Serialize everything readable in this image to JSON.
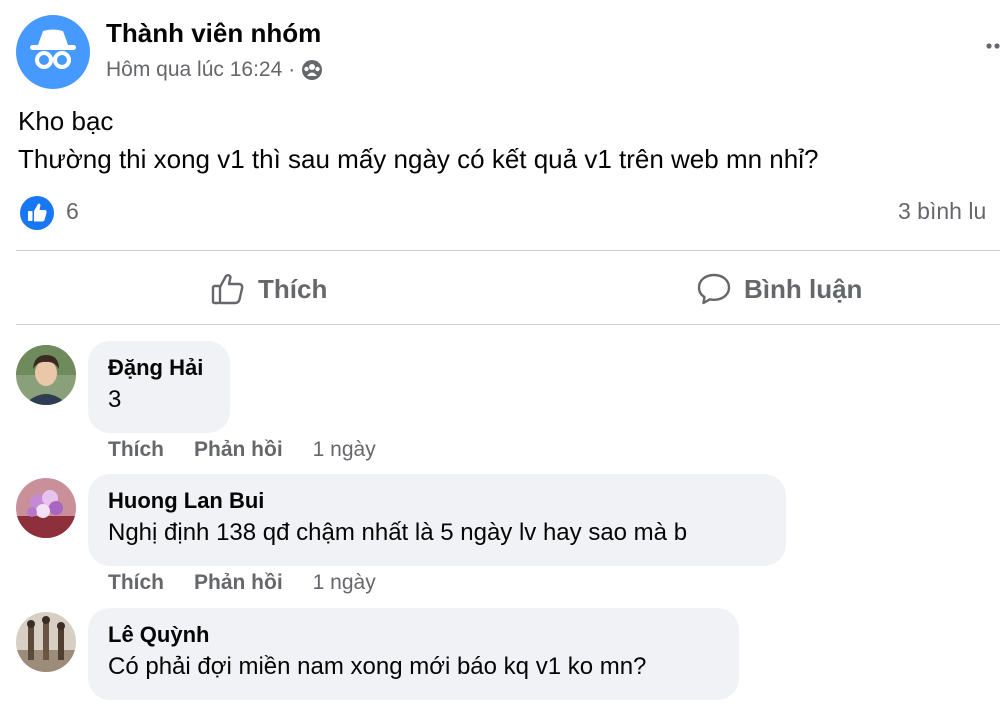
{
  "post": {
    "author": "Thành viên nhóm",
    "timestamp": "Hôm qua lúc 16:24",
    "separator": "·",
    "audience_icon": "group-icon",
    "lines": [
      "Kho bạc",
      "Thường thi xong v1 thì sau mấy ngày có kết quả v1 trên web mn nhỉ?"
    ],
    "reaction_count": "6",
    "comment_count": "3 bình lu"
  },
  "actions": {
    "like_label": "Thích",
    "comment_label": "Bình luận"
  },
  "comments": [
    {
      "name": "Đặng Hải",
      "text": "3",
      "like": "Thích",
      "reply": "Phản hồi",
      "time": "1 ngày"
    },
    {
      "name": "Huong Lan Bui",
      "text": "Nghị định 138 qđ chậm nhất là 5 ngày lv hay sao mà b",
      "like": "Thích",
      "reply": "Phản hồi",
      "time": "1 ngày"
    },
    {
      "name": "Lê Quỳnh",
      "text": "Có phải đợi miền nam xong mới báo kq v1 ko mn?"
    }
  ],
  "colors": {
    "accent": "#1877f2",
    "secondary_text": "#65676b",
    "bubble": "#f0f2f5",
    "anon_avatar": "#4599ff"
  }
}
